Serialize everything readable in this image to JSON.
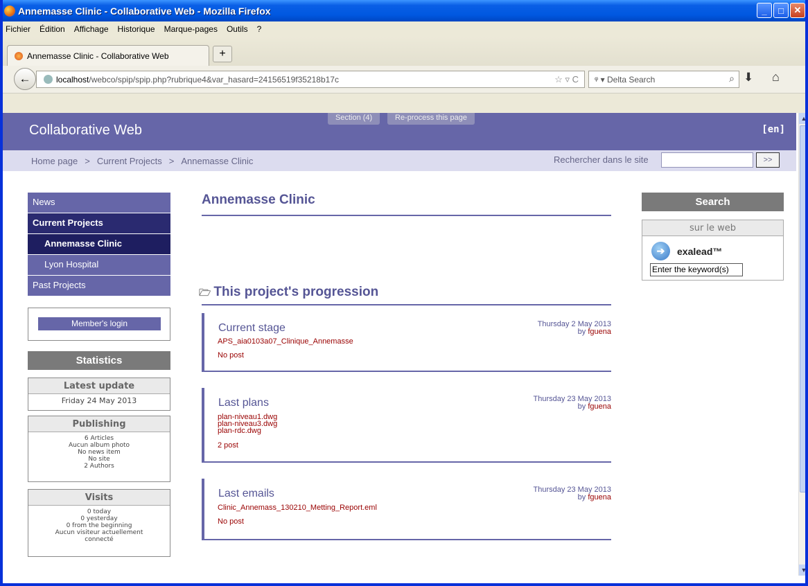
{
  "window": {
    "title": "Annemasse Clinic - Collaborative Web - Mozilla Firefox"
  },
  "menu": [
    "Fichier",
    "Édition",
    "Affichage",
    "Historique",
    "Marque-pages",
    "Outils",
    "?"
  ],
  "tab": {
    "label": "Annemasse Clinic - Collaborative Web",
    "new_tab": "+"
  },
  "url": {
    "host": "localhost",
    "path": "/webco/spip/spip.php?rubrique4&var_hasard=24156519f35218b17c"
  },
  "search_engine": {
    "placeholder": "Delta Search"
  },
  "site": {
    "title": "Collaborative Web",
    "lang": "[en]",
    "top_tabs": [
      "Section (4)",
      "Re-process this page"
    ],
    "breadcrumb": [
      "Home page",
      "Current Projects",
      "Annemasse Clinic"
    ],
    "breadcrumb_sep": ">",
    "search_label": "Rechercher dans le site",
    "search_button": ">>"
  },
  "nav": [
    {
      "label": "News"
    },
    {
      "label": "Current Projects"
    },
    {
      "label": "Annemasse Clinic"
    },
    {
      "label": "Lyon Hospital"
    },
    {
      "label": "Past Projects"
    }
  ],
  "login": {
    "label": "Member's login"
  },
  "stats": {
    "title": "Statistics",
    "latest_update": {
      "heading": "Latest update",
      "value": "Friday 24 May 2013"
    },
    "publishing": {
      "heading": "Publishing",
      "lines": [
        "6 Articles",
        "Aucun album photo",
        "No news item",
        "No site",
        "2 Authors"
      ]
    },
    "visits": {
      "heading": "Visits",
      "lines": [
        "0 today",
        "0 yesterday",
        "0 from the beginning",
        "Aucun visiteur actuellement",
        "connecté"
      ]
    }
  },
  "main": {
    "title": "Annemasse Clinic",
    "progression_heading": "This project's progression",
    "cards": [
      {
        "title": "Current stage",
        "date": "Thursday 2 May 2013",
        "by": "by",
        "author": "fguena",
        "files": [
          "APS_aia0103a07_Clinique_Annemasse"
        ],
        "posts": "No post"
      },
      {
        "title": "Last plans",
        "date": "Thursday 23 May 2013",
        "by": "by",
        "author": "fguena",
        "files": [
          "plan-niveau1.dwg",
          "plan-niveau3.dwg",
          "plan-rdc.dwg"
        ],
        "posts": "2 post"
      },
      {
        "title": "Last emails",
        "date": "Thursday 23 May 2013",
        "by": "by",
        "author": "fguena",
        "files": [
          "Clinic_Annemass_130210_Metting_Report.eml"
        ],
        "posts": "No post"
      }
    ]
  },
  "right": {
    "search_title": "Search",
    "web_heading": "sur le web",
    "brand": "exalead™",
    "keyword_placeholder": "Enter the keyword(s)"
  },
  "colors": {
    "accent": "#6666a8",
    "accent_dark": "#2a2a70",
    "link_red": "#990000"
  }
}
